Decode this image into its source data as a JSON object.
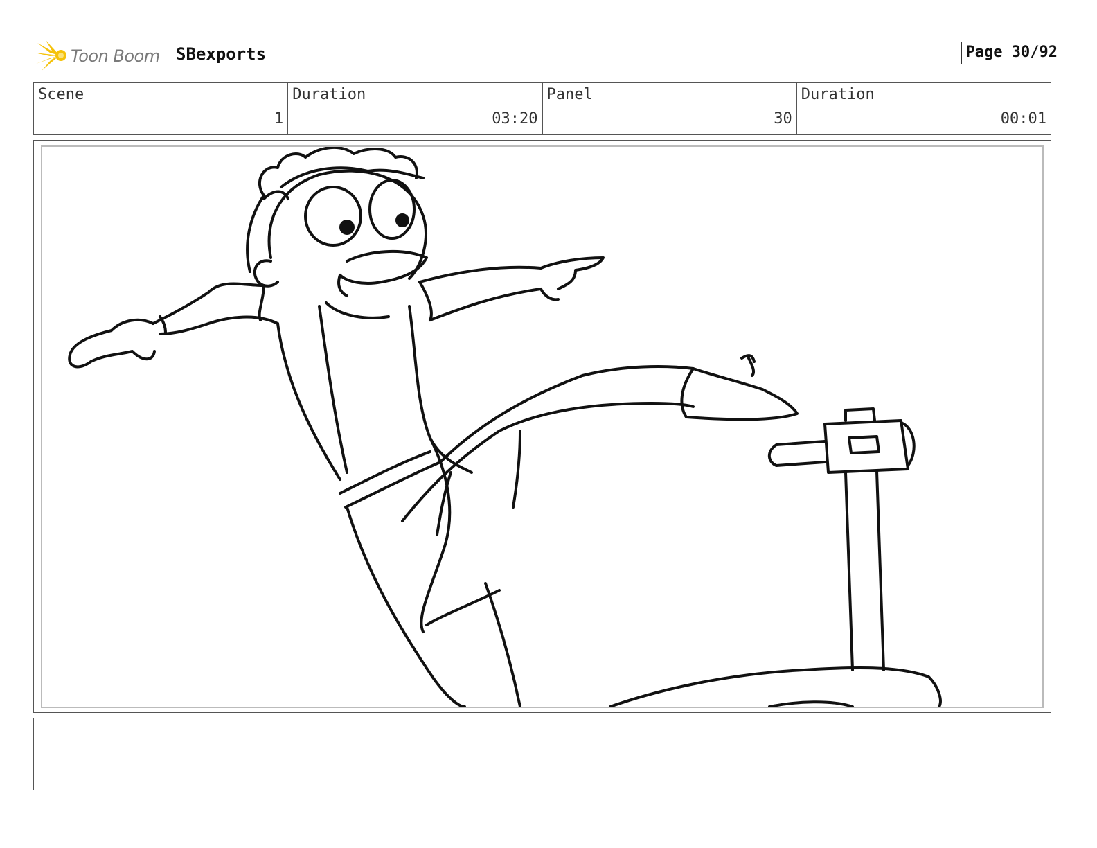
{
  "header": {
    "brand_name": "Toon Boom",
    "project_title": "SBexports",
    "page_label": "Page 30/92"
  },
  "info": {
    "scene_label": "Scene",
    "scene_value": "1",
    "scene_duration_label": "Duration",
    "scene_duration_value": "03:20",
    "panel_label": "Panel",
    "panel_value": "30",
    "panel_duration_label": "Duration",
    "panel_duration_value": "00:01"
  },
  "notes": {
    "text": ""
  },
  "colors": {
    "logo_accent": "#f5c20a",
    "border": "#555555",
    "frame_border": "#bbbbbb",
    "ink": "#111111"
  }
}
